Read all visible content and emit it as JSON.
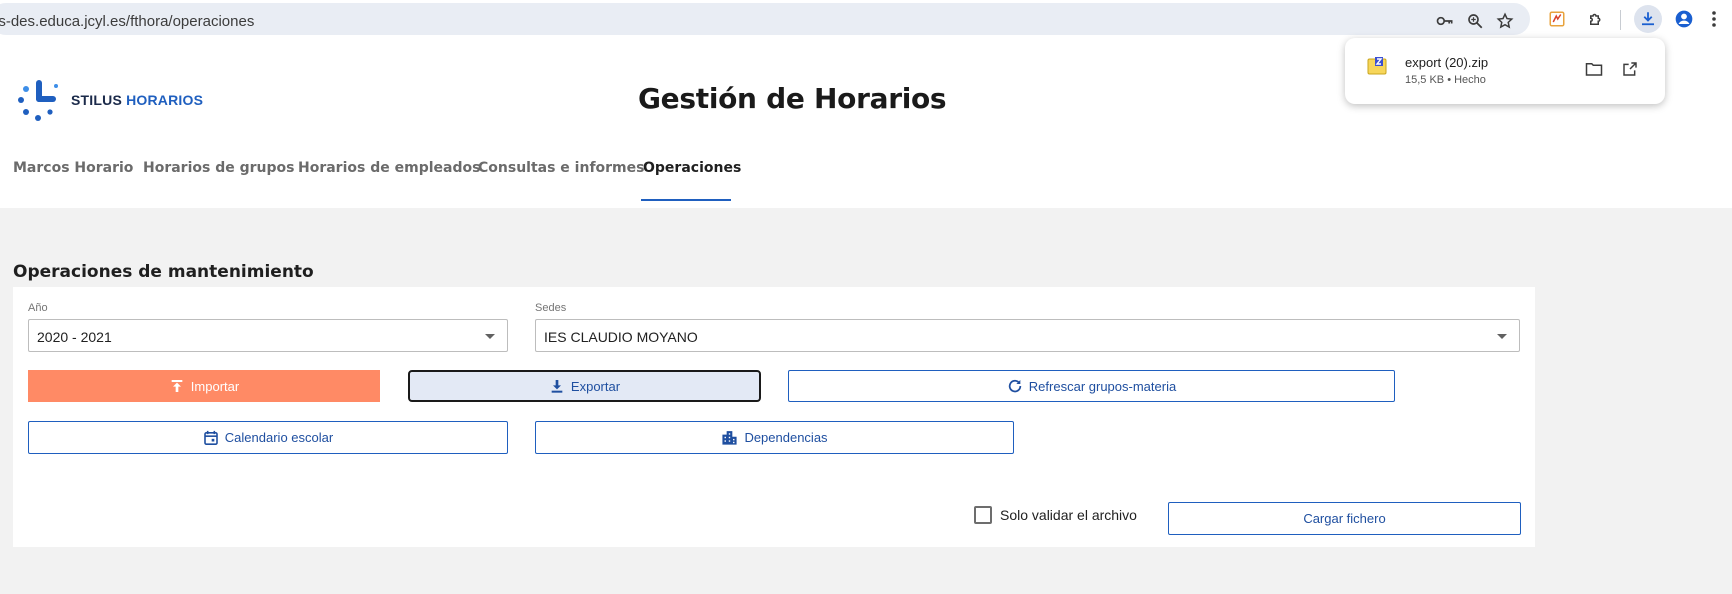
{
  "browser": {
    "url": "us-des.educa.jcyl.es/fthora/operaciones",
    "icons": [
      "key-icon",
      "zoom-icon",
      "star-icon",
      "extension-colored-icon",
      "puzzle-icon",
      "download-icon",
      "profile-icon",
      "menu-icon"
    ]
  },
  "download_popup": {
    "file_name": "export (20).zip",
    "meta": "15,5 KB • Hecho"
  },
  "app": {
    "brand_part1": "STILUS",
    "brand_part2": "HORARIOS",
    "title": "Gestión de Horarios"
  },
  "tabs": [
    {
      "label": "Marcos Horario",
      "active": false
    },
    {
      "label": "Horarios de grupos",
      "active": false
    },
    {
      "label": "Horarios de empleados",
      "active": false
    },
    {
      "label": "Consultas e informes",
      "active": false
    },
    {
      "label": "Operaciones",
      "active": true
    }
  ],
  "main": {
    "section_title": "Operaciones de mantenimiento",
    "year": {
      "label": "Año",
      "value": "2020 - 2021"
    },
    "sedes": {
      "label": "Sedes",
      "value": "IES CLAUDIO MOYANO"
    },
    "buttons": {
      "importar": "Importar",
      "exportar": "Exportar",
      "refrescar": "Refrescar grupos-materia",
      "calendario": "Calendario escolar",
      "dependencias": "Dependencias",
      "cargar": "Cargar fichero"
    },
    "checkbox_label": "Solo validar el archivo",
    "checkbox_checked": false
  },
  "colors": {
    "accent_blue": "#1f5fbf",
    "import_orange": "#ff8a65"
  }
}
